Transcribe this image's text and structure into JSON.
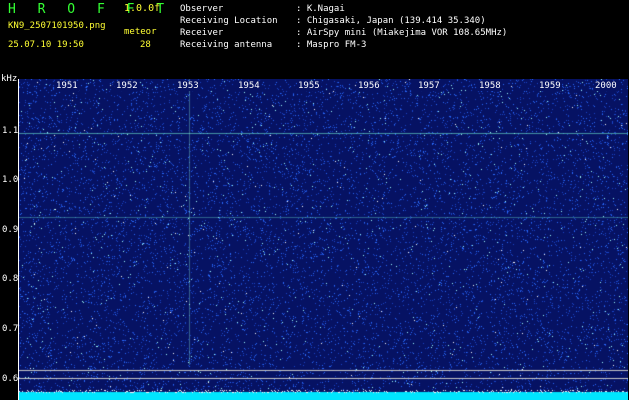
{
  "header": {
    "logo": "H R O F F T",
    "version": "1.0.0f",
    "filename": "KN9_2507101950.png",
    "timestamp": "25.07.10 19:50",
    "meteor_label": "meteor",
    "meteor_count": "28",
    "info": [
      {
        "label": "Observer",
        "value": ": K.Nagai"
      },
      {
        "label": "Receiving Location",
        "value": ": Chigasaki, Japan (139.414 35.340)"
      },
      {
        "label": "Receiver",
        "value": ": AirSpy mini (Miakejima VOR 108.65MHz)"
      },
      {
        "label": "Receiving antenna",
        "value": ": Maspro FM-3"
      }
    ]
  },
  "spectrogram": {
    "y_unit": "kHz",
    "y_ticks": [
      "1.1",
      "1.0",
      "0.9",
      "0.8",
      "0.7",
      "0.6"
    ],
    "x_ticks": [
      "1951",
      "1952",
      "1953",
      "1954",
      "1955",
      "1956",
      "1957",
      "1958",
      "1959",
      "2000"
    ],
    "colors": {
      "background": "#061263",
      "noise": "#2a6cff",
      "bright": "#9fffff",
      "baseline": "#00e5ff"
    }
  }
}
